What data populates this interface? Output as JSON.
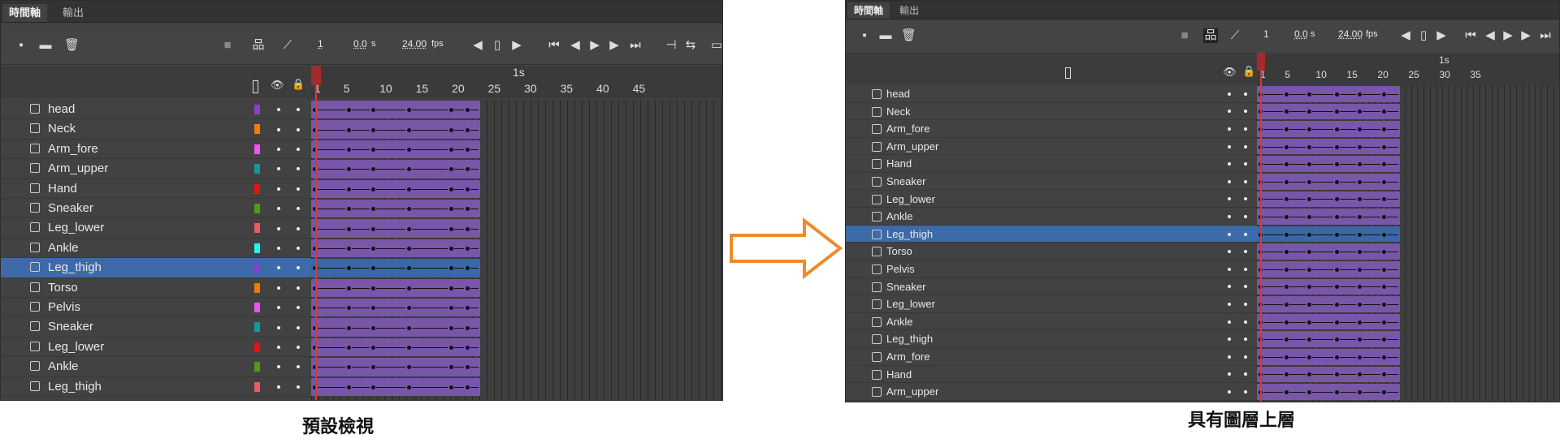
{
  "tabs": [
    "時間軸",
    "輸出"
  ],
  "toolbar": {
    "frame": "1",
    "time": "0.0",
    "time_unit": "s",
    "fps": "24.00",
    "fps_unit": "fps"
  },
  "ruler": {
    "seconds_label": "1s",
    "ticks": [
      "1",
      "5",
      "10",
      "15",
      "20",
      "25",
      "30",
      "35",
      "40",
      "45"
    ],
    "ticks_right": [
      "1",
      "5",
      "10",
      "15",
      "20",
      "25",
      "30",
      "35"
    ]
  },
  "left_layers": [
    {
      "name": "head",
      "color": "#8a3fd1"
    },
    {
      "name": "Neck",
      "color": "#f07d0a"
    },
    {
      "name": "Arm_fore",
      "color": "#ee55f0"
    },
    {
      "name": "Arm_upper",
      "color": "#129a98"
    },
    {
      "name": "Hand",
      "color": "#e31414"
    },
    {
      "name": "Sneaker",
      "color": "#4f9a17"
    },
    {
      "name": "Leg_lower",
      "color": "#f05a64"
    },
    {
      "name": "Ankle",
      "color": "#22f3f3"
    },
    {
      "name": "Leg_thigh",
      "color": "#8a3fd1",
      "selected": true
    },
    {
      "name": "Torso",
      "color": "#f07d0a"
    },
    {
      "name": "Pelvis",
      "color": "#ee55f0"
    },
    {
      "name": "Sneaker",
      "color": "#129a98"
    },
    {
      "name": "Leg_lower",
      "color": "#e31414"
    },
    {
      "name": "Ankle",
      "color": "#4f9a17"
    },
    {
      "name": "Leg_thigh",
      "color": "#f05a64"
    }
  ],
  "right_layers": [
    {
      "name": "head"
    },
    {
      "name": "Neck"
    },
    {
      "name": "Arm_fore"
    },
    {
      "name": "Arm_upper"
    },
    {
      "name": "Hand"
    },
    {
      "name": "Sneaker"
    },
    {
      "name": "Leg_lower"
    },
    {
      "name": "Ankle"
    },
    {
      "name": "Leg_thigh",
      "selected": true
    },
    {
      "name": "Torso"
    },
    {
      "name": "Pelvis"
    },
    {
      "name": "Sneaker"
    },
    {
      "name": "Leg_lower"
    },
    {
      "name": "Ankle"
    },
    {
      "name": "Leg_thigh"
    },
    {
      "name": "Arm_fore"
    },
    {
      "name": "Hand"
    },
    {
      "name": "Arm_upper"
    }
  ],
  "captions": {
    "left": "預設檢視",
    "right": "具有圖層上層"
  },
  "colors": {
    "arrow": "#f08a2a",
    "span": "#7856a8",
    "selected_row": "#3d6aa8",
    "playhead": "#d23a3a"
  }
}
